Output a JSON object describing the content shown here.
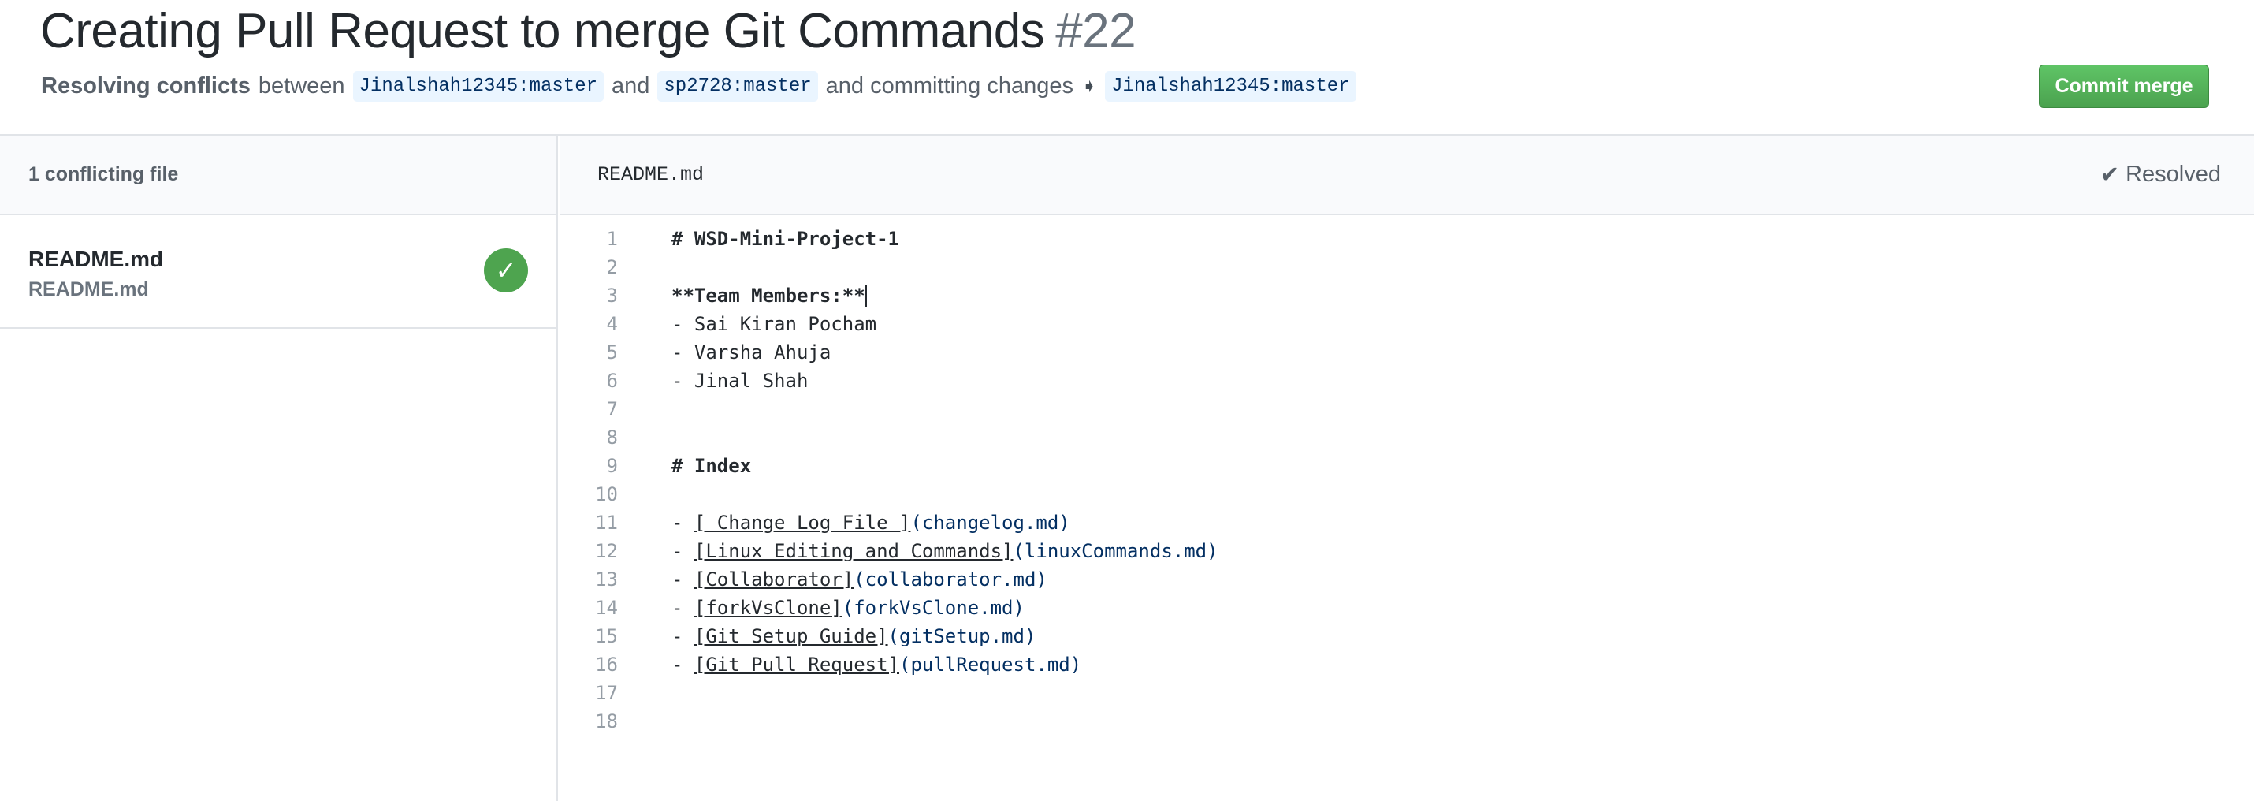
{
  "header": {
    "title": "Creating Pull Request to merge Git Commands",
    "number": "#22",
    "subtitle": {
      "lead": "Resolving conflicts",
      "between": "between",
      "branch_a": "Jinalshah12345:master",
      "and": "and",
      "branch_b": "sp2728:master",
      "committing": "and committing changes",
      "target": "Jinalshah12345:master"
    },
    "commit_button": "Commit merge"
  },
  "sidebar": {
    "heading": "1 conflicting file",
    "files": [
      {
        "name": "README.md",
        "path": "README.md"
      }
    ]
  },
  "editor": {
    "filename": "README.md",
    "status": "Resolved",
    "lines": [
      {
        "n": "1",
        "text": "# WSD-Mini-Project-1",
        "style": "bold"
      },
      {
        "n": "2",
        "text": ""
      },
      {
        "n": "3",
        "text": "**Team Members:**",
        "style": "bold"
      },
      {
        "n": "4",
        "text": "- Sai Kiran Pocham"
      },
      {
        "n": "5",
        "text": "- Varsha Ahuja"
      },
      {
        "n": "6",
        "text": "- Jinal Shah"
      },
      {
        "n": "7",
        "text": ""
      },
      {
        "n": "8",
        "text": ""
      },
      {
        "n": "9",
        "text": "# Index",
        "style": "bold"
      },
      {
        "n": "10",
        "text": ""
      },
      {
        "n": "11",
        "link": "[ Change Log File ]",
        "url": "(changelog.md)"
      },
      {
        "n": "12",
        "link": "[Linux Editing and Commands]",
        "url": "(linuxCommands.md)"
      },
      {
        "n": "13",
        "link": "[Collaborator]",
        "url": "(collaborator.md)"
      },
      {
        "n": "14",
        "link": "[forkVsClone]",
        "url": "(forkVsClone.md)"
      },
      {
        "n": "15",
        "link": "[Git Setup Guide]",
        "url": "(gitSetup.md)"
      },
      {
        "n": "16",
        "link": "[Git Pull Request]",
        "url": "(pullRequest.md)"
      },
      {
        "n": "17",
        "text": ""
      },
      {
        "n": "18",
        "text": ""
      }
    ]
  }
}
